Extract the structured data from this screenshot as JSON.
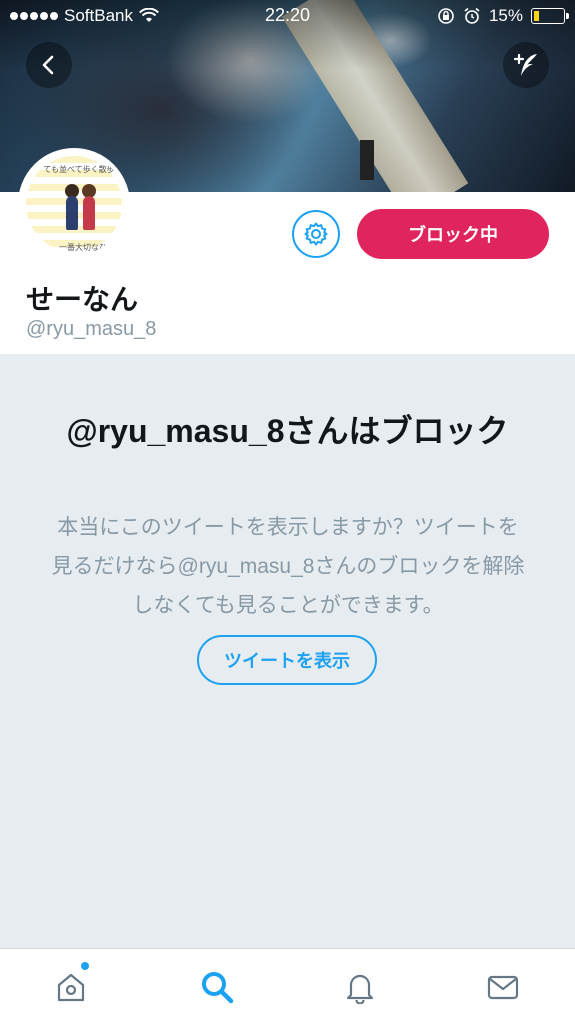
{
  "status_bar": {
    "carrier": "SoftBank",
    "time": "22:20",
    "battery": "15%"
  },
  "header": {
    "back_icon": "chevron-left-icon",
    "compose_icon": "compose-tweet-icon"
  },
  "profile": {
    "display_name": "せーなん",
    "handle": "@ryu_masu_8",
    "block_button_label": "ブロック中",
    "settings_icon": "gear-icon",
    "avatar_text_top": "ても並べて歩く散歩道",
    "avatar_text_bottom": "一番大切なひ"
  },
  "blocked_notice": {
    "title": "@ryu_masu_8さんはブロック",
    "body": "本当にこのツイートを表示しますか？ツイートを見るだけなら@ryu_masu_8さんのブロックを解除しなくても見ることができます。",
    "show_button_label": "ツイートを表示"
  },
  "tab_bar": {
    "tabs": [
      "home-icon",
      "search-icon",
      "notifications-icon",
      "messages-icon"
    ],
    "active": "search-icon"
  },
  "colors": {
    "accent": "#1da1f2",
    "block": "#e0245e",
    "background": "#e6ecf0"
  }
}
